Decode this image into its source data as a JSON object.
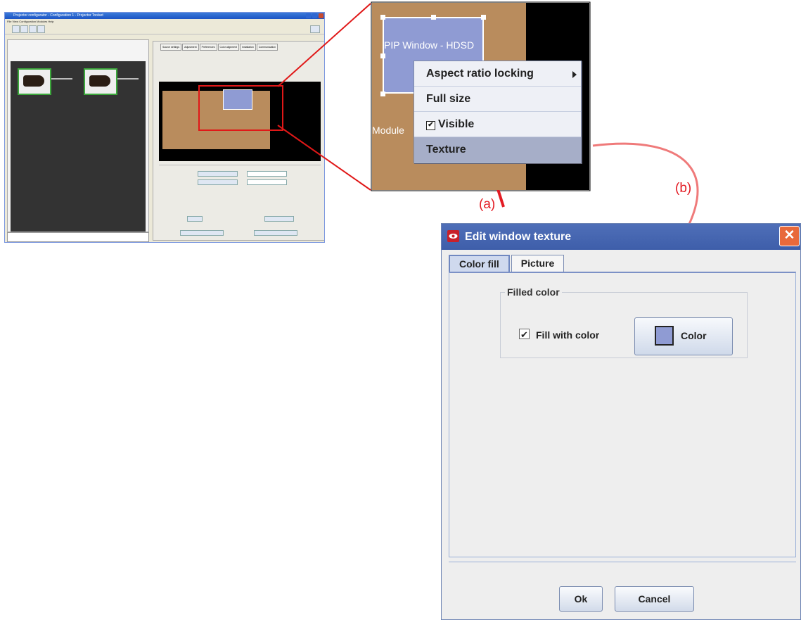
{
  "app_thumbnail": {
    "title": "Projector configurator - Configuration 1 - Projector Toolset",
    "menu": "File  View  Configuration  Modules  Help",
    "tabs": [
      "Source settings",
      "Adjustment",
      "Preferences",
      "Color alignment",
      "Installation",
      "Communication"
    ]
  },
  "zoom_view": {
    "pip_window_label": "PIP Window - HDSD",
    "module_label": "Module",
    "context_menu": [
      {
        "label": "Aspect ratio locking",
        "submenu": true
      },
      {
        "label": "Full size"
      },
      {
        "label": "Visible",
        "checked": true
      },
      {
        "label": "Texture",
        "selected": true
      }
    ]
  },
  "annotations": {
    "a": "(a)",
    "b": "(b)"
  },
  "dialog": {
    "title": "Edit window texture",
    "close_symbol": "✕",
    "tabs": [
      "Color fill",
      "Picture"
    ],
    "active_tab": "Color fill",
    "group_label": "Filled color",
    "fill_checkbox_label": "Fill with color",
    "fill_checked": true,
    "checkmark": "✔",
    "color_button_label": "Color",
    "swatch_color": "#8f9bd3",
    "ok_label": "Ok",
    "cancel_label": "Cancel"
  },
  "colors": {
    "accent_red": "#e31b23",
    "title_blue": "#4466b0",
    "canvas_tan": "#b98c5d"
  }
}
